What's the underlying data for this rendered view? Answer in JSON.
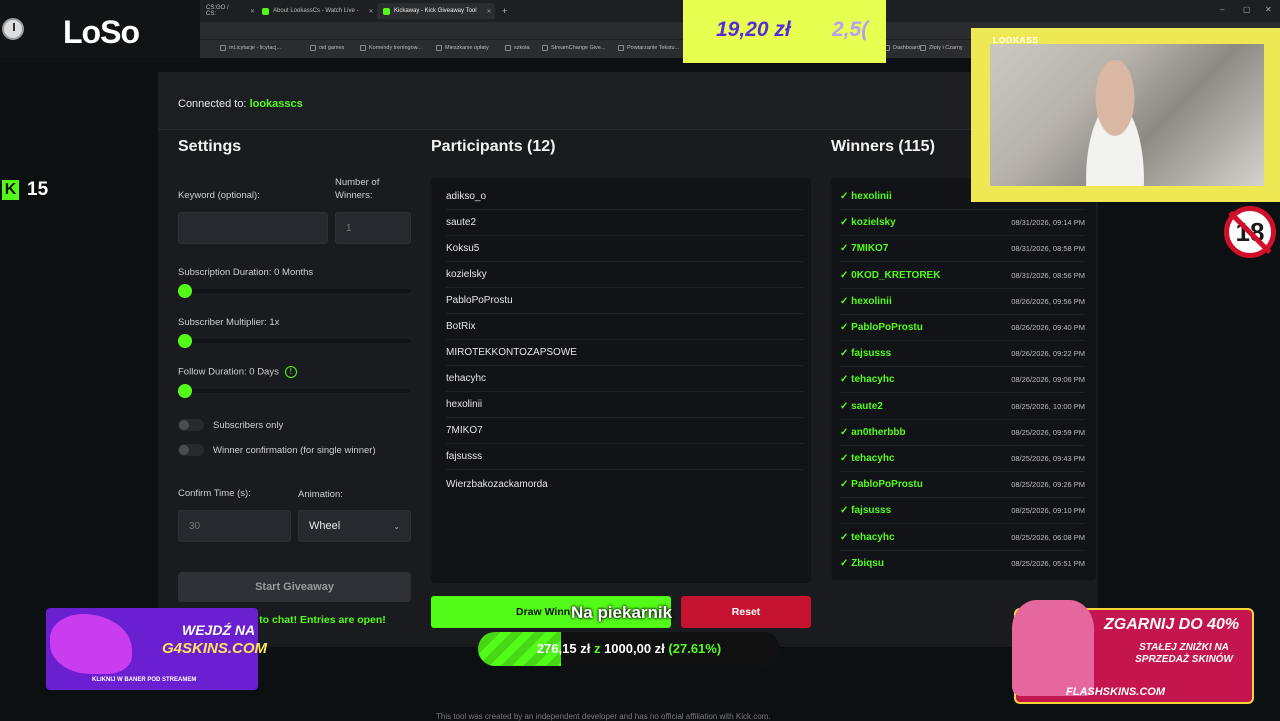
{
  "browser": {
    "tabs": [
      {
        "label": "CS:GO / CS:",
        "active": false
      },
      {
        "label": "About LookassCs - Watch Live -",
        "active": false
      },
      {
        "label": "Kickaway - Kick Giveaway Tool",
        "active": true
      }
    ],
    "new_tab": "+",
    "bookmarks": [
      "mLicytacje - licytacj...",
      "oid games",
      "Komendy treningow...",
      "Mieszkanie opłaty",
      "szkoła",
      "StreamChange Give...",
      "Powtarzanie Tekstu...",
      "Dashboard",
      "Złoty i Czarny"
    ]
  },
  "stream": {
    "logo": "LoSo",
    "kick_viewers": "15",
    "kick_logo": "K",
    "webcam_name": "LOOKASS",
    "age_badge": "18",
    "donation_amount": "19,20 zł",
    "donation_amount_2": "2,5(",
    "goal": {
      "title": "Na piekarnik",
      "current": "276,15 zł",
      "sep": "z",
      "target": "1000,00 zł",
      "percent_label": "(27.61%)",
      "fraction": 0.2761
    },
    "ad_left": {
      "line1": "WEJDŹ NA",
      "line2": "G4SKINS.COM",
      "line3": "KLIKNIJ W BANER POD STREAMEM"
    },
    "ad_right": {
      "line1": "ZGARNIJ DO 40%",
      "line2": "STAŁEJ ZNIŻKI NA SPRZEDAŻ SKINÓW",
      "line3": "FLASHSKINS.COM"
    }
  },
  "app": {
    "connected_prefix": "Connected to: ",
    "connected_channel": "lookasscs",
    "settings": {
      "title": "Settings",
      "keyword_label": "Keyword (optional):",
      "keyword_value": "",
      "winners_label_1": "Number of",
      "winners_label_2": "Winners:",
      "winners_placeholder": "1",
      "sub_duration": "Subscription Duration: 0 Months",
      "sub_multiplier": "Subscriber Multiplier: 1x",
      "follow_duration": "Follow Duration:  0  Days",
      "follow_info": "!",
      "subs_only": "Subscribers only",
      "winner_confirm": "Winner confirmation (for single winner)",
      "confirm_label": "Confirm Time (s):",
      "confirm_placeholder": "30",
      "animation_label": "Animation:",
      "animation_value": "Wheel",
      "start_button": "Start Giveaway",
      "entries_msg": "ed to chat! Entries are open!"
    },
    "participants": {
      "title": "Participants (12)",
      "names": [
        "adikso_o",
        "saute2",
        "Koksu5",
        "kozielsky",
        "PabloPoProstu",
        "BotRix",
        "MIROTEKKONTOZAPSOWE",
        "tehacyhc",
        "hexolinii",
        "7MIKO7",
        "fajsusss",
        "Wierzbakozackamorda"
      ],
      "draw_button": "Draw Winn",
      "reset_button": "Reset"
    },
    "winners": {
      "title": "Winners (115)",
      "rows": [
        {
          "name": "✓ hexolinii",
          "date": ""
        },
        {
          "name": "✓ kozielsky",
          "date": "08/31/2026, 09:14 PM"
        },
        {
          "name": "✓ 7MIKO7",
          "date": "08/31/2026, 08:58 PM"
        },
        {
          "name": "✓ 0KOD_KRETOREK",
          "date": "08/31/2026, 08:56 PM"
        },
        {
          "name": "✓ hexolinii",
          "date": "08/26/2026, 09:56 PM"
        },
        {
          "name": "✓ PabloPoProstu",
          "date": "08/26/2026, 09:40 PM"
        },
        {
          "name": "✓ fajsusss",
          "date": "08/26/2026, 09:22 PM"
        },
        {
          "name": "✓ tehacyhc",
          "date": "08/26/2026, 09:06 PM"
        },
        {
          "name": "✓ saute2",
          "date": "08/25/2026, 10:00 PM"
        },
        {
          "name": "✓ an0therbbb",
          "date": "08/25/2026, 09:59 PM"
        },
        {
          "name": "✓ tehacyhc",
          "date": "08/25/2026, 09:43 PM"
        },
        {
          "name": "✓ PabloPoProstu",
          "date": "08/25/2026, 09:26 PM"
        },
        {
          "name": "✓ fajsusss",
          "date": "08/25/2026, 09:10 PM"
        },
        {
          "name": "✓ tehacyhc",
          "date": "08/25/2026, 06:08 PM"
        },
        {
          "name": "✓ Zbiqsu",
          "date": "08/25/2026, 05:51 PM"
        }
      ]
    },
    "footer": "This tool was created by an independent developer and has no official affiliation with Kick.com."
  },
  "colors": {
    "accent": "#53fc18",
    "danger": "#c41230",
    "panel": "#191b1f"
  }
}
